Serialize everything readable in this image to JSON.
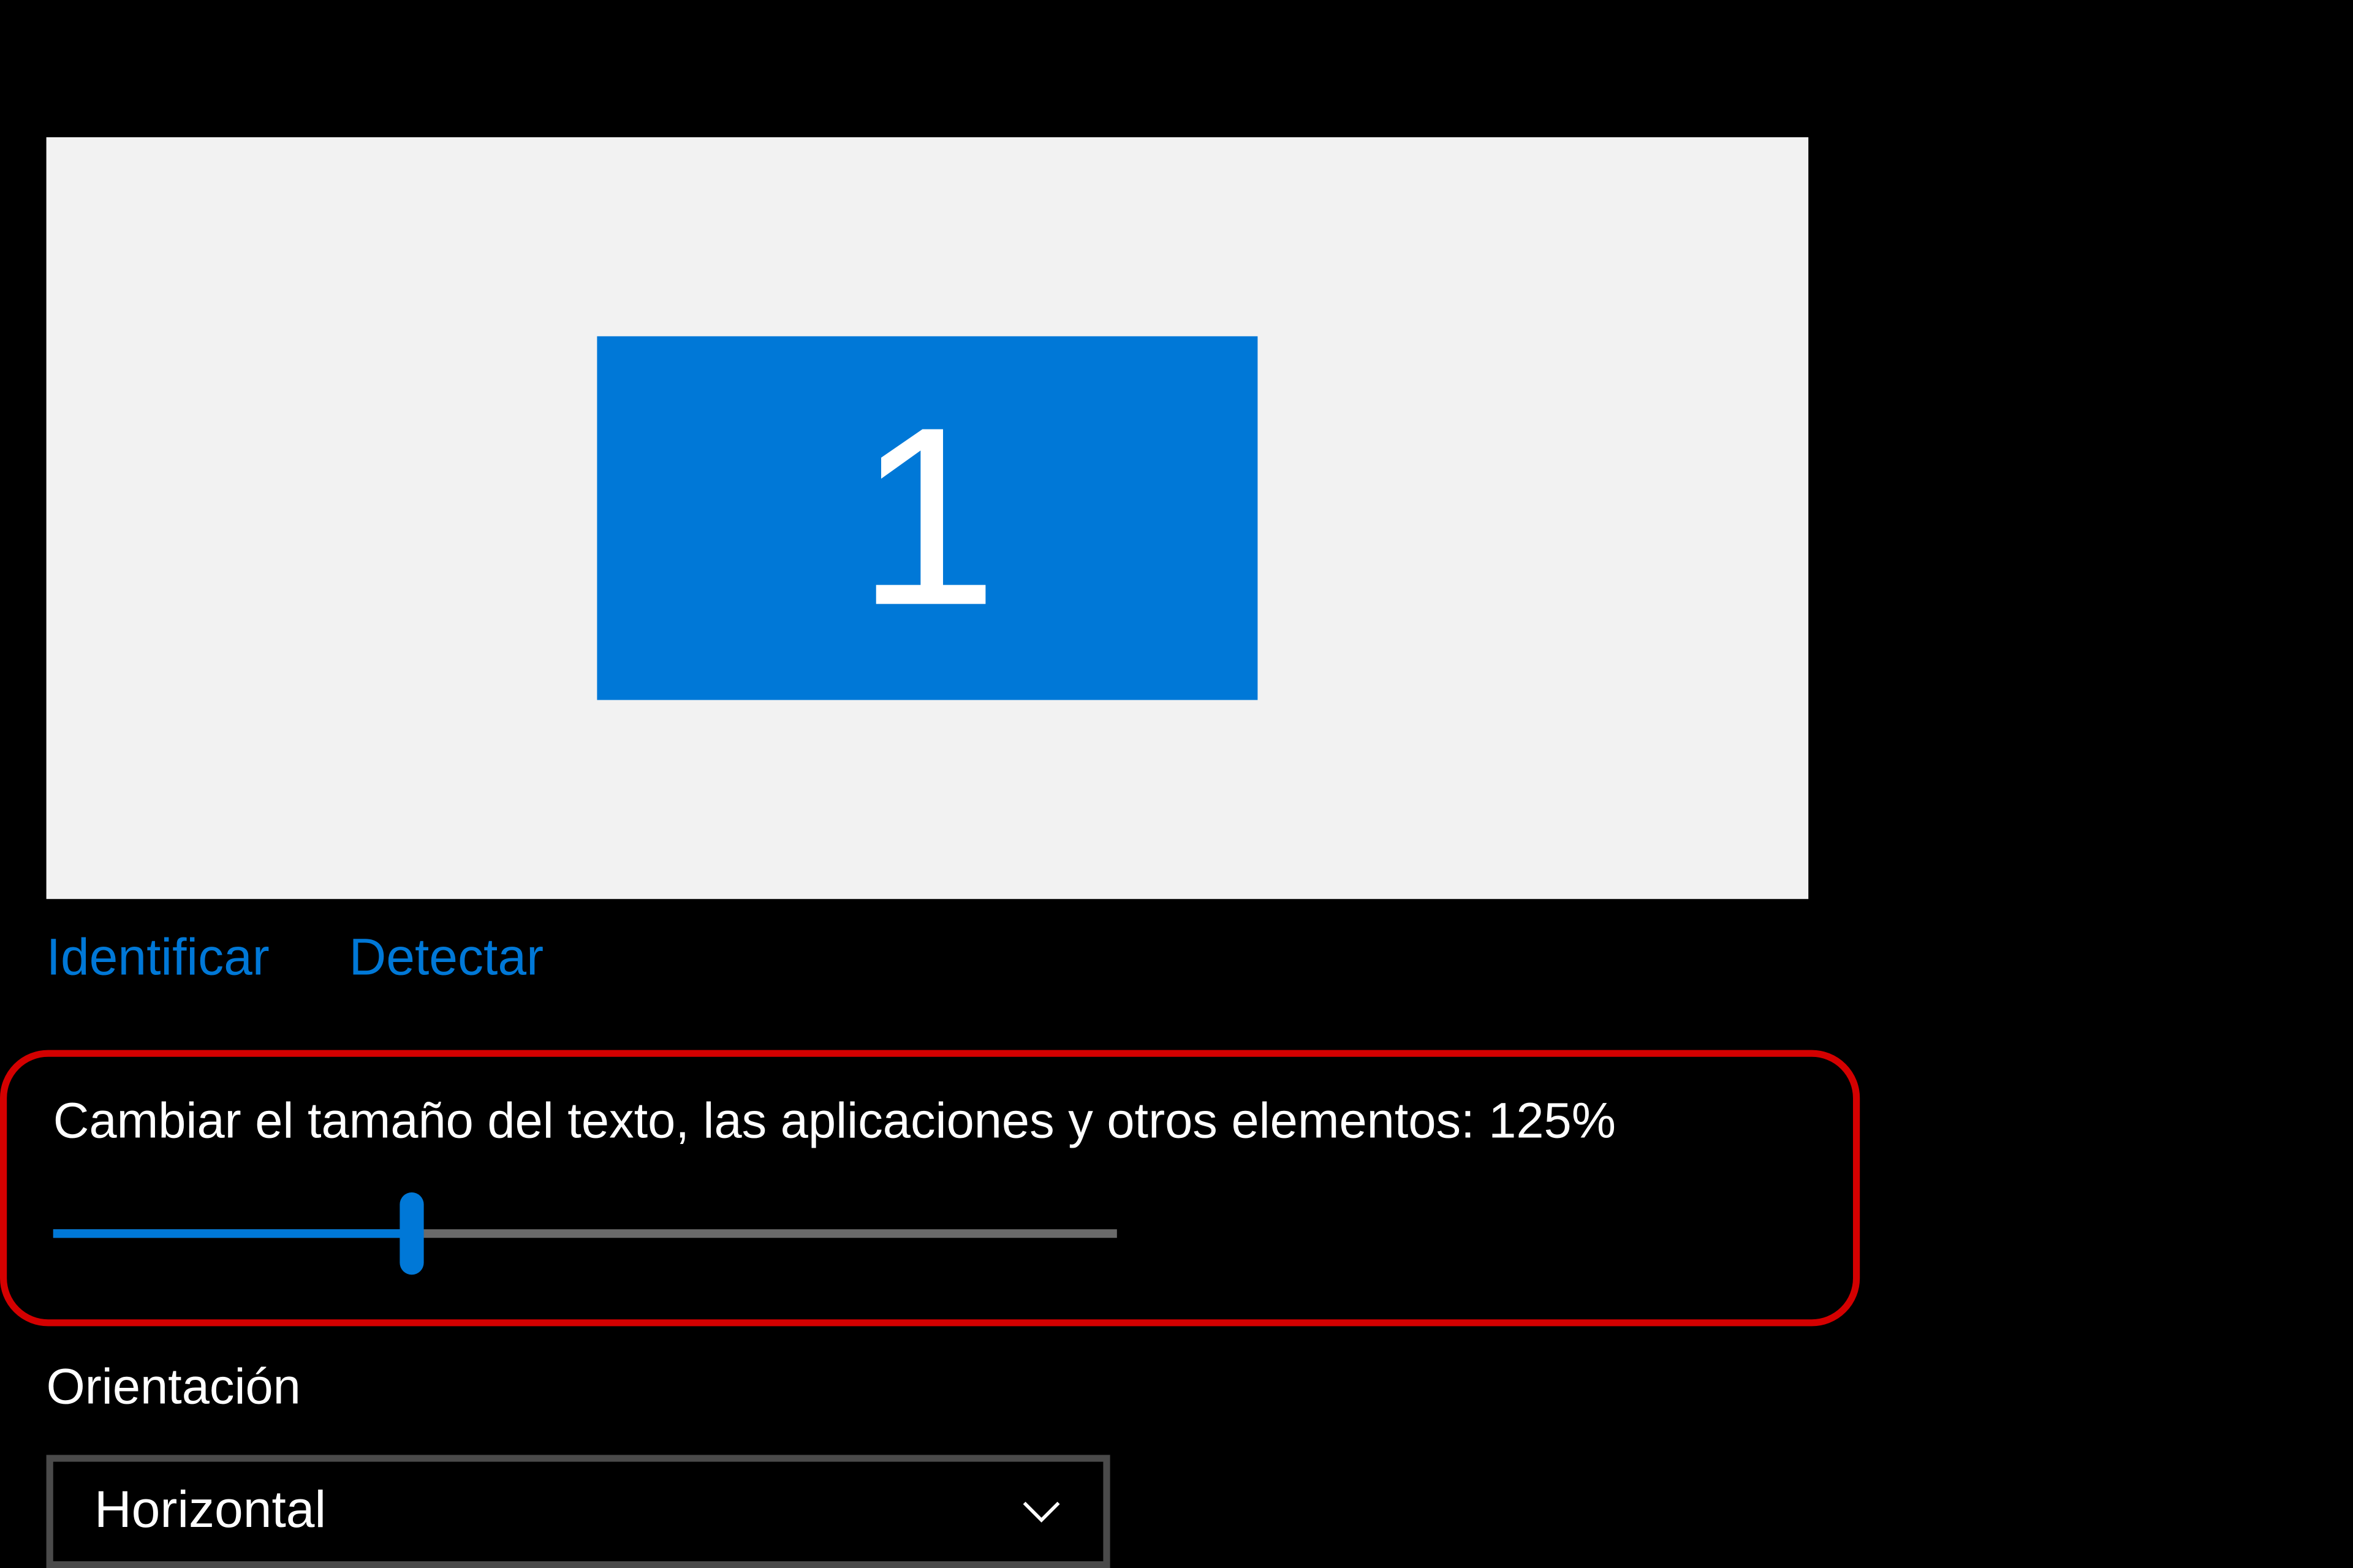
{
  "display": {
    "monitor_label": "1"
  },
  "links": {
    "identify": "Identificar",
    "detect": "Detectar"
  },
  "scale": {
    "label": "Cambiar el tamaño del texto, las aplicaciones y otros elementos: 125%",
    "value_percent": 125,
    "slider_fill_ratio": 0.335
  },
  "orientation": {
    "label": "Orientación",
    "selected": "Horizontal"
  }
}
